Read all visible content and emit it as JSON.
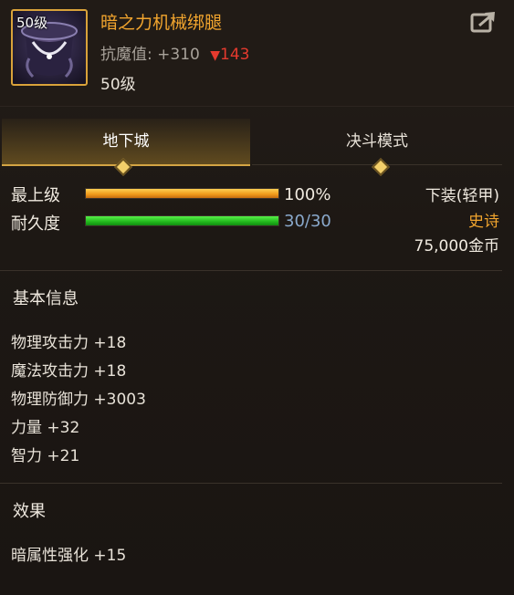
{
  "item": {
    "name": "暗之力机械绑腿",
    "icon_level": "50级",
    "resist_label": "抗魔值:",
    "resist_value": "+310",
    "resist_diff": "143",
    "level_text": "50级"
  },
  "tabs": [
    {
      "label": "地下城",
      "active": true
    },
    {
      "label": "决斗模式",
      "active": false
    }
  ],
  "stats": {
    "upgrade_label": "最上级",
    "upgrade_value": "100%",
    "upgrade_fill": 1.0,
    "durability_label": "耐久度",
    "durability_value": "30/30",
    "durability_fill": 1.0
  },
  "equip_info": {
    "type": "下装(轻甲)",
    "rarity": "史诗",
    "price": "75,000金币"
  },
  "basic_info": {
    "title": "基本信息",
    "attributes": [
      "物理攻击力 +18",
      "魔法攻击力 +18",
      "物理防御力 +3003",
      "力量 +32",
      "智力 +21"
    ]
  },
  "effects": {
    "title": "效果",
    "items": [
      "暗属性强化 +15"
    ]
  },
  "colors": {
    "accent_gold": "#f2a52e",
    "down_red": "#e53a2e",
    "durability_blue": "#8aa9cc"
  },
  "icons": [
    "share-icon",
    "item-icon"
  ]
}
